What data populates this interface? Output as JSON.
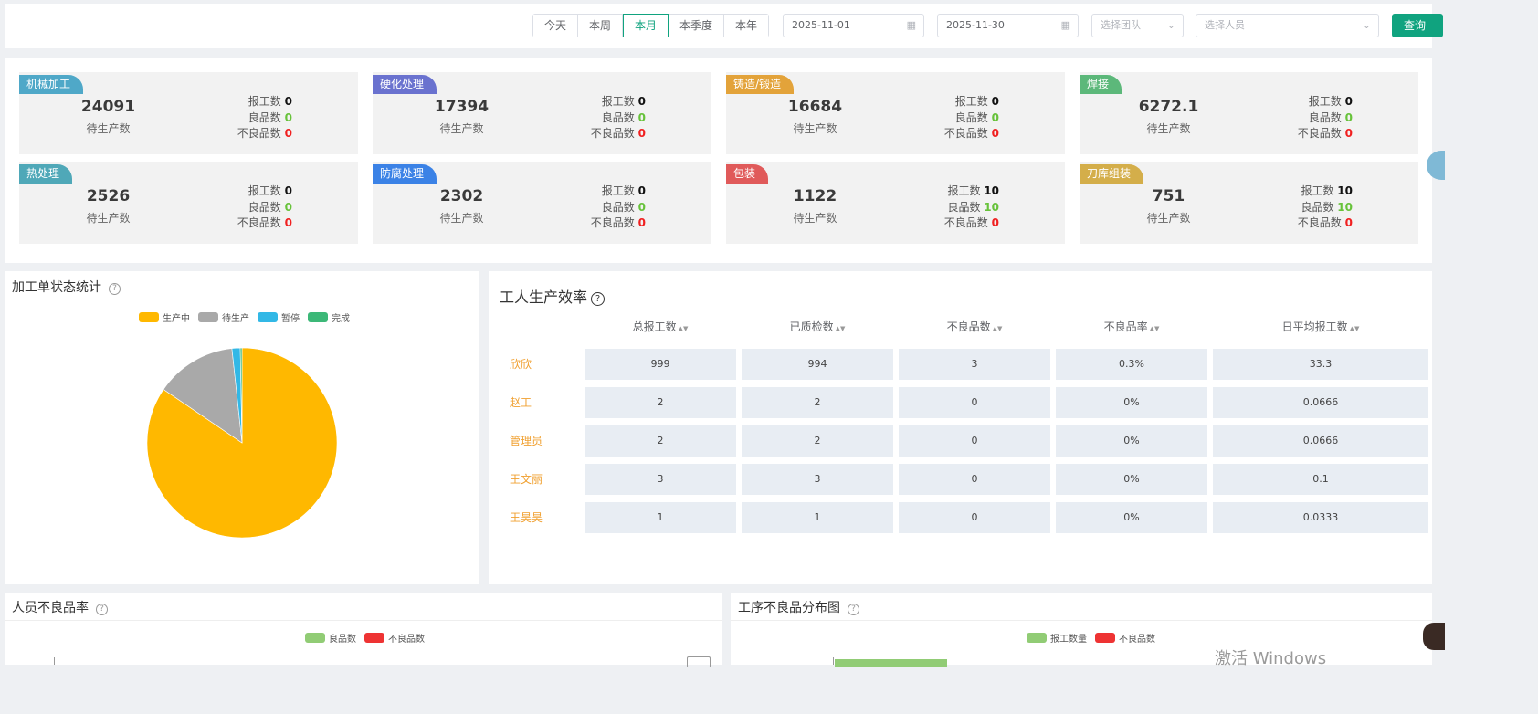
{
  "toolbar": {
    "periods": [
      "今天",
      "本周",
      "本月",
      "本季度",
      "本年"
    ],
    "active_period": "本月",
    "start_date": "2025-11-01",
    "end_date": "2025-11-30",
    "team_placeholder": "选择团队",
    "person_placeholder": "选择人员",
    "query_label": "查询"
  },
  "labels": {
    "pending": "待生产数",
    "reported": "报工数",
    "good": "良品数",
    "bad": "不良品数"
  },
  "processes": [
    {
      "name": "机械加工",
      "color": "#4fa8c8",
      "pending": "24091",
      "reported": "0",
      "good": "0",
      "bad": "0"
    },
    {
      "name": "硬化处理",
      "color": "#6a72cf",
      "pending": "17394",
      "reported": "0",
      "good": "0",
      "bad": "0"
    },
    {
      "name": "铸造/锻造",
      "color": "#e3a33a",
      "pending": "16684",
      "reported": "0",
      "good": "0",
      "bad": "0"
    },
    {
      "name": "焊接",
      "color": "#5cb87a",
      "pending": "6272.1",
      "reported": "0",
      "good": "0",
      "bad": "0"
    },
    {
      "name": "热处理",
      "color": "#4fa8b8",
      "pending": "2526",
      "reported": "0",
      "good": "0",
      "bad": "0"
    },
    {
      "name": "防腐处理",
      "color": "#3b82e6",
      "pending": "2302",
      "reported": "0",
      "good": "0",
      "bad": "0"
    },
    {
      "name": "包装",
      "color": "#e05a5a",
      "pending": "1122",
      "reported": "10",
      "good": "10",
      "bad": "0"
    },
    {
      "name": "刀库组装",
      "color": "#d4ae4a",
      "pending": "751",
      "reported": "10",
      "good": "10",
      "bad": "0"
    }
  ],
  "order_status": {
    "title": "加工单状态统计",
    "chart_data": {
      "type": "pie",
      "categories": [
        "生产中",
        "待生产",
        "暂停",
        "完成"
      ],
      "values": [
        84.5,
        13.8,
        1.4,
        0.3
      ],
      "colors": [
        "#ffb800",
        "#a9a9a9",
        "#32b8e6",
        "#3cb878"
      ],
      "legend": "top"
    }
  },
  "efficiency": {
    "title": "工人生产效率",
    "columns": [
      "总报工数",
      "已质检数",
      "不良品数",
      "不良品率",
      "日平均报工数"
    ],
    "rows": [
      {
        "name": "欣欣",
        "values": [
          "999",
          "994",
          "3",
          "0.3%",
          "33.3"
        ]
      },
      {
        "name": "赵工",
        "values": [
          "2",
          "2",
          "0",
          "0%",
          "0.0666"
        ]
      },
      {
        "name": "管理员",
        "values": [
          "2",
          "2",
          "0",
          "0%",
          "0.0666"
        ]
      },
      {
        "name": "王文丽",
        "values": [
          "3",
          "3",
          "0",
          "0%",
          "0.1"
        ]
      },
      {
        "name": "王昊昊",
        "values": [
          "1",
          "1",
          "0",
          "0%",
          "0.0333"
        ]
      }
    ]
  },
  "defect_rate": {
    "title": "人员不良品率",
    "legend": [
      "良品数",
      "不良品数"
    ],
    "legend_colors": [
      "#91cc75",
      "#ee3333"
    ]
  },
  "defect_dist": {
    "title": "工序不良品分布图",
    "legend": [
      "报工数量",
      "不良品数"
    ],
    "legend_colors": [
      "#91cc75",
      "#ee3333"
    ]
  },
  "watermark": "激活 Windows"
}
